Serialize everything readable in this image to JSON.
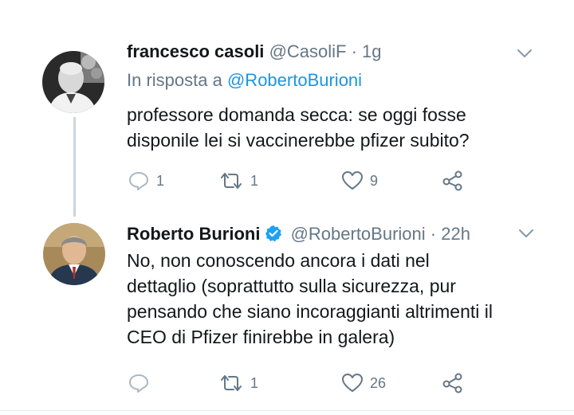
{
  "colors": {
    "text": "#14171a",
    "secondary": "#657786",
    "link": "#1b95e0",
    "verified": "#1da1f2",
    "divider": "#e6ecf0"
  },
  "tweets": [
    {
      "name": "francesco casoli",
      "handle": "@CasoliF",
      "separator": "·",
      "time": "1g",
      "reply_prefix": "In risposta a",
      "reply_mention": "@RobertoBurioni",
      "text_lines": [
        "professore domanda secca: se oggi fosse",
        "disponile lei si vaccinerebbe pfizer subito?"
      ],
      "verified": false,
      "counts": {
        "replies": "1",
        "retweets": "1",
        "likes": "9"
      },
      "icons": [
        "reply-icon",
        "retweet-icon",
        "like-icon",
        "share-icon",
        "chevron-down-icon"
      ]
    },
    {
      "name": "Roberto Burioni",
      "handle": "@RobertoBurioni",
      "separator": "·",
      "time": "22h",
      "text_lines": [
        "No, non conoscendo ancora i dati nel",
        "dettaglio (soprattutto sulla sicurezza, pur",
        "pensando che siano incoraggianti altrimenti il",
        "CEO di Pfizer finirebbe in galera)"
      ],
      "verified": true,
      "counts": {
        "replies": "",
        "retweets": "1",
        "likes": "26"
      },
      "icons": [
        "verified-badge-icon",
        "reply-icon",
        "retweet-icon",
        "like-icon",
        "share-icon",
        "chevron-down-icon"
      ]
    }
  ]
}
